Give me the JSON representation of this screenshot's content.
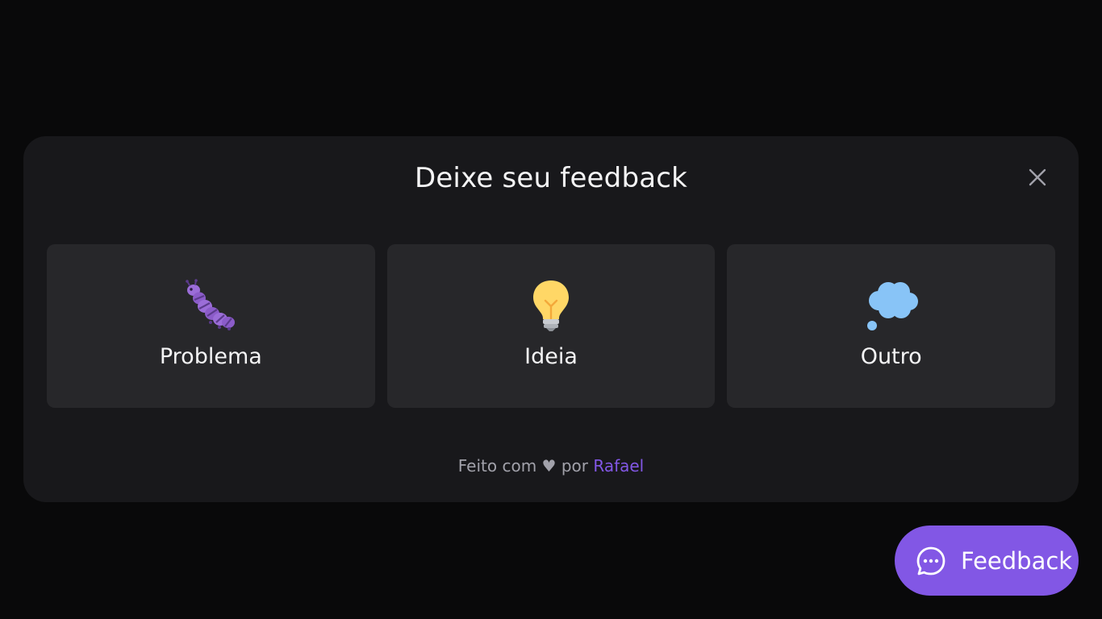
{
  "modal": {
    "title": "Deixe seu feedback",
    "options": [
      {
        "label": "Problema",
        "icon": "bug-icon"
      },
      {
        "label": "Ideia",
        "icon": "lightbulb-icon"
      },
      {
        "label": "Outro",
        "icon": "thought-bubble-icon"
      }
    ],
    "footer": {
      "prefix": "Feito com",
      "heart": "♥",
      "middle": "por",
      "author": "Rafael"
    }
  },
  "fab": {
    "label": "Feedback",
    "icon": "chat-bubble-icon"
  },
  "colors": {
    "background": "#09090a",
    "panel": "#18181b",
    "card": "#27272a",
    "accent": "#8257e5",
    "text": "#f4f4f5",
    "muted": "#a1a1aa"
  }
}
